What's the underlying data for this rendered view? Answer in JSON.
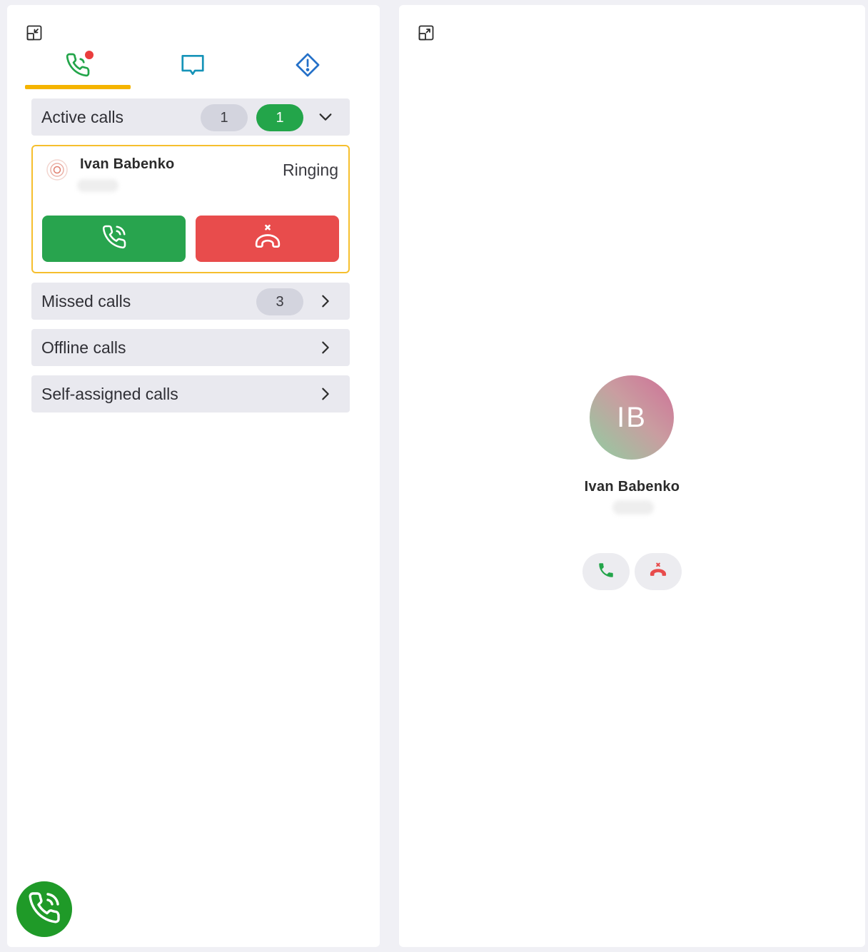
{
  "tabs": [
    {
      "name": "calls",
      "icon": "phone-icon",
      "active": true,
      "has_notification": true
    },
    {
      "name": "chats",
      "icon": "chat-bubble-icon",
      "active": false
    },
    {
      "name": "alerts",
      "icon": "alert-diamond-icon",
      "active": false
    }
  ],
  "sections": {
    "active_calls": {
      "label": "Active calls",
      "count_waiting": "1",
      "count_ringing": "1",
      "expanded": true
    },
    "missed_calls": {
      "label": "Missed calls",
      "count": "3"
    },
    "offline_calls": {
      "label": "Offline calls"
    },
    "self_assigned_calls": {
      "label": "Self-assigned calls"
    }
  },
  "active_call": {
    "caller_name": "Ivan Babenko",
    "caller_number": "",
    "status": "Ringing"
  },
  "contact": {
    "initials": "IB",
    "name": "Ivan Babenko",
    "number": ""
  },
  "colors": {
    "accent": "#f5b400",
    "accept": "#28a44e",
    "decline": "#e84c4c",
    "floating_button": "#1f9a28",
    "notification": "#ea3d3d"
  }
}
